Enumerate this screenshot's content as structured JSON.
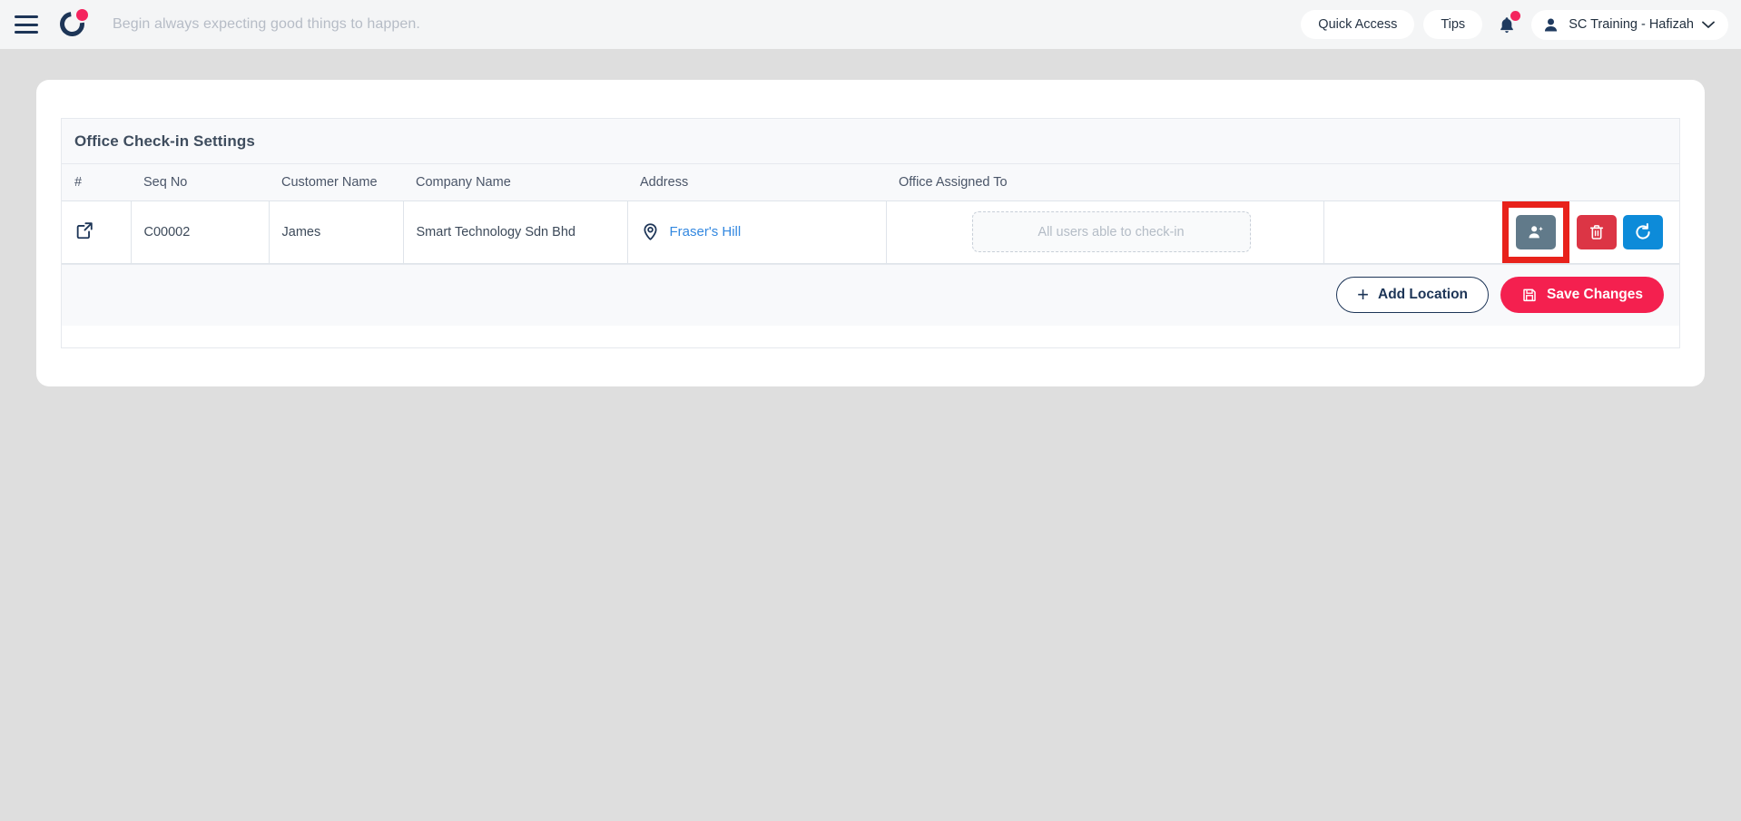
{
  "topbar": {
    "menu_icon": "hamburger-icon",
    "logo_icon": "brand-logo-icon",
    "tagline": "Begin always expecting good things to happen.",
    "quick_access_label": "Quick Access",
    "tips_label": "Tips",
    "notification_icon": "bell-icon",
    "avatar_icon": "user-avatar-icon",
    "user_name": "SC Training - Hafizah",
    "chevron_icon": "chevron-down-icon",
    "accent_pink": "#f4245e",
    "navy": "#1d3557"
  },
  "panel": {
    "title": "Office Check-in Settings"
  },
  "table": {
    "columns": [
      "#",
      "Seq No",
      "Customer Name",
      "Company Name",
      "Address",
      "Office Assigned To",
      ""
    ],
    "rows": [
      {
        "index_icon": "external-link-icon",
        "seq_no": "C00002",
        "customer_name": "James",
        "company_name": "Smart Technology Sdn Bhd",
        "address_icon": "map-pin-icon",
        "address": "Fraser's Hill",
        "office_assigned_placeholder": "All users able to check-in",
        "actions": {
          "assign_users": {
            "icon": "add-user-icon",
            "color": "#617a8a",
            "highlighted": true
          },
          "delete": {
            "icon": "trash-icon",
            "color": "#dc3545",
            "highlighted": false
          },
          "refresh": {
            "icon": "refresh-icon",
            "color": "#0d8bd9",
            "highlighted": false
          }
        }
      }
    ]
  },
  "footer": {
    "add_location_label": "Add Location",
    "add_location_icon": "plus-icon",
    "save_changes_label": "Save Changes",
    "save_icon": "save-disk-icon",
    "save_color": "#f4204f"
  }
}
